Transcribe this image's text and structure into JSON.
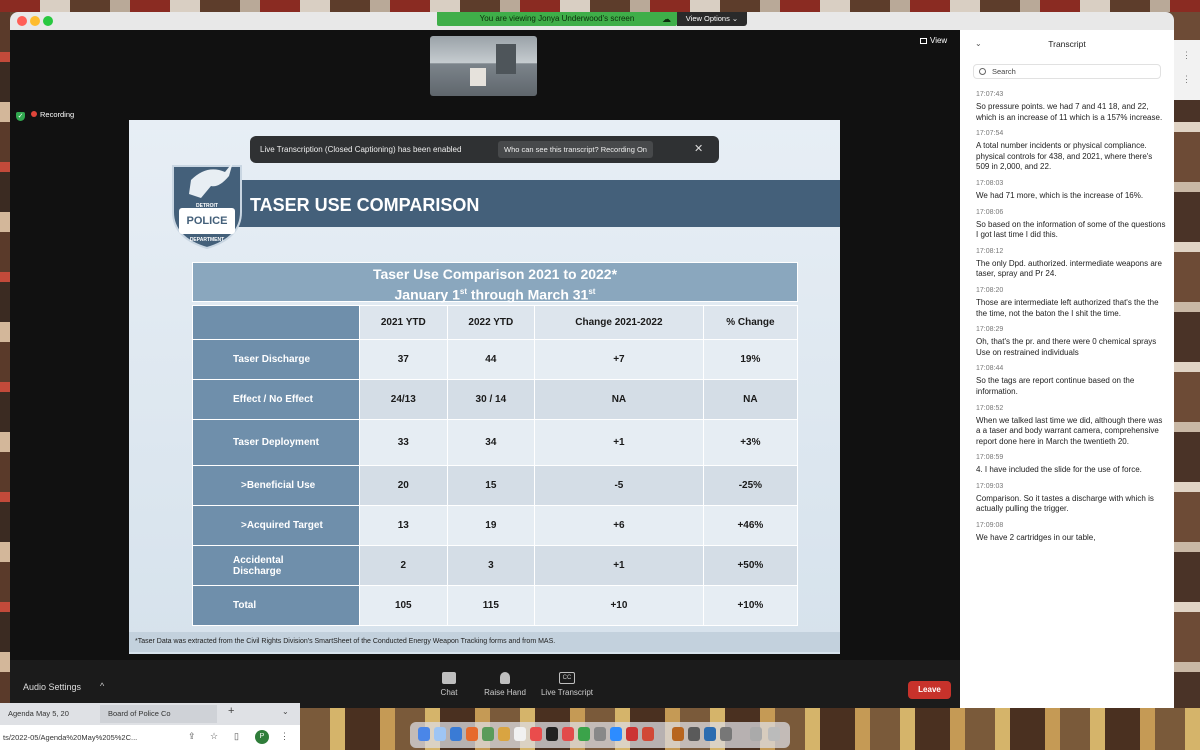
{
  "share_banner": {
    "text": "You are viewing Jonya Underwood's screen",
    "view_options": "View Options ⌄"
  },
  "video": {
    "view_label": "View",
    "recording_label": "Recording"
  },
  "captions_banner": {
    "message": "Live Transcription (Closed Captioning) has been enabled",
    "who_can_see": "Who can see this transcript? Recording On",
    "close": "✕"
  },
  "slide": {
    "title": "TASER USE COMPARISON",
    "logo": {
      "line1": "DETROIT",
      "line2": "POLICE",
      "line3": "DEPARTMENT"
    },
    "table_title_line1": "Taser Use Comparison 2021 to 2022*",
    "table_title_line2_pre": "January 1",
    "table_title_line2_sup1": "st",
    "table_title_line2_mid": " through March 31",
    "table_title_line2_sup2": "st",
    "columns": [
      "2021 YTD",
      "2022 YTD",
      "Change 2021-2022",
      "% Change"
    ],
    "rows": [
      {
        "label": "Taser Discharge",
        "values": [
          "37",
          "44",
          "+7",
          "19%"
        ]
      },
      {
        "label": "Effect / No Effect",
        "values": [
          "24/13",
          "30 / 14",
          "NA",
          "NA"
        ]
      },
      {
        "label": "Taser Deployment",
        "values": [
          "33",
          "34",
          "+1",
          "+3%"
        ]
      },
      {
        "label": ">Beneficial Use",
        "values": [
          "20",
          "15",
          "-5",
          "-25%"
        ]
      },
      {
        "label": ">Acquired Target",
        "values": [
          "13",
          "19",
          "+6",
          "+46%"
        ]
      },
      {
        "label": "Accidental Discharge",
        "values": [
          "2",
          "3",
          "+1",
          "+50%"
        ]
      },
      {
        "label": "Total",
        "values": [
          "105",
          "115",
          "+10",
          "+10%"
        ]
      }
    ],
    "footnote": "*Taser Data was extracted from the Civil Rights Division's SmartSheet of the Conducted Energy Weapon Tracking forms and from MAS."
  },
  "toolbar": {
    "audio_settings": "Audio Settings",
    "audio_caret": "^",
    "chat": "Chat",
    "raise_hand": "Raise Hand",
    "live_transcript": "Live Transcript",
    "cc": "CC",
    "leave": "Leave"
  },
  "transcript": {
    "title": "Transcript",
    "collapse": "⌄",
    "search_placeholder": "Search",
    "entries": [
      {
        "time": "17:07:43",
        "text": "So pressure points. we had 7 and 41 18, and 22, which is an increase of 11 which is a 157% increase."
      },
      {
        "time": "17:07:54",
        "text": "A total number incidents or physical compliance. physical controls for 438, and 2021, where there's 509 in 2,000, and 22."
      },
      {
        "time": "17:08:03",
        "text": "We had 71 more, which is the increase of 16%."
      },
      {
        "time": "17:08:06",
        "text": "So based on the information of some of the questions I got last time I did this."
      },
      {
        "time": "17:08:12",
        "text": "The only Dpd. authorized. intermediate weapons are taser, spray and Pr 24."
      },
      {
        "time": "17:08:20",
        "text": "Those are intermediate left authorized that's the the the time, not the baton the I shit the time."
      },
      {
        "time": "17:08:29",
        "text": "Oh, that's the pr. and there were 0 chemical sprays Use on restrained individuals"
      },
      {
        "time": "17:08:44",
        "text": "So the tags are report continue based on the information."
      },
      {
        "time": "17:08:52",
        "text": "When we talked last time we did, although there was a a taser and body warrant camera, comprehensive report done here in March the twentieth 20."
      },
      {
        "time": "17:08:59",
        "text": "4. I have included the slide for the use of force."
      },
      {
        "time": "17:09:03",
        "text": "Comparison. So it tastes a discharge with which is actually pulling the trigger."
      },
      {
        "time": "17:09:08",
        "text": "We have 2 cartridges in our table,"
      }
    ]
  },
  "browser": {
    "tab1": "Agenda May 5, 20",
    "tab2": "Board of Police Co",
    "new_tab": "+",
    "caret": "⌄",
    "address": "ts/2022-05/Agenda%20May%205%2C...",
    "avatar": "P"
  }
}
